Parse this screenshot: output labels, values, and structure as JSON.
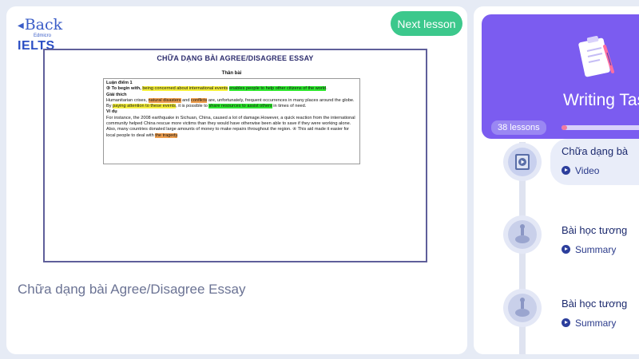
{
  "header": {
    "logo_back": "Back",
    "logo_edmicro": "Edmicro",
    "logo_ielts": "IELTS",
    "next_button": "Next lesson"
  },
  "slide": {
    "title": "CHỮA DẠNG BÀI AGREE/DISAGREE ESSAY",
    "section_heading": "Thân bài",
    "point_label": "Luận điểm 1",
    "p1_a": "③ To begin with, ",
    "p1_hl1": "being concerned about international events",
    "p1_b": " ",
    "p1_hl2": "enables people to help other citizens of the world",
    "p1_c": ".",
    "explain_label": "Giải thích",
    "e_a": "Humanitarian crises, ",
    "e_hl1": "natural disasters",
    "e_b": " and ",
    "e_hl2": "conflicts",
    "e_c": " are, unfortunately, frequent occurrences in many places around the globe. By ",
    "e_hl3": "paying attention to these events",
    "e_d": ", it is possible to ",
    "e_hl4": "share resources to assist others",
    "e_e": " in times of need.",
    "example_label": "Ví dụ",
    "ex_a": "For instance, the 2008 earthquake in Sichuan, China, caused a lot of damage.However, a quick reaction from the international community helped China rescue more victims than they would have otherwise been able to save if they were working alone. Also, many countries donated large amounts of money to make repairs throughout the region. ④ This aid made it easier for local people to deal with ",
    "ex_hl": "the tragedy",
    "ex_b": "."
  },
  "lesson_title": "Chữa dạng bài Agree/Disagree Essay",
  "course": {
    "title": "Writing Task",
    "lessons_count": "38 lessons",
    "progress": 0.05,
    "accent_color": "#7b5cf0"
  },
  "lessons": [
    {
      "title": "Chữa dạng bà",
      "type": "Video"
    },
    {
      "title": "Bài học tương",
      "type": "Summary"
    },
    {
      "title": "Bài học tương",
      "type": "Summary"
    }
  ]
}
